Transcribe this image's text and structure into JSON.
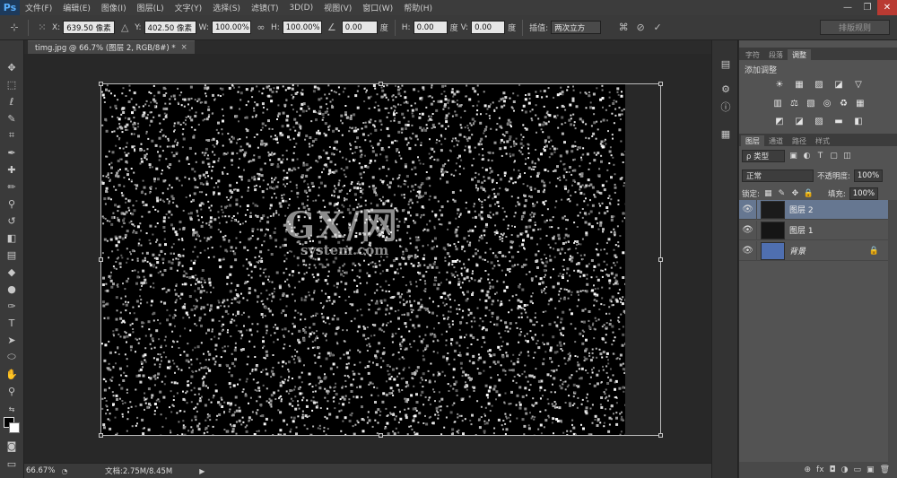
{
  "app": {
    "logo": "Ps"
  },
  "menu": [
    "文件(F)",
    "编辑(E)",
    "图像(I)",
    "图层(L)",
    "文字(Y)",
    "选择(S)",
    "滤镜(T)",
    "3D(D)",
    "视图(V)",
    "窗口(W)",
    "帮助(H)"
  ],
  "window_controls": {
    "minimize": "—",
    "maximize": "❐",
    "close": "✕"
  },
  "options": {
    "x_label": "X:",
    "x_value": "639.50 像素",
    "y_label": "Y:",
    "y_value": "402.50 像素",
    "w_label": "W:",
    "w_value": "100.00%",
    "h_label": "H:",
    "h_value": "100.00%",
    "angle_value": "0.00",
    "angle_unit": "度",
    "hskew_label": "H:",
    "hskew_value": "0.00",
    "hskew_unit": "度",
    "vskew_label": "V:",
    "vskew_value": "0.00",
    "vskew_unit": "度",
    "interp_label": "插值:",
    "interp_value": "两次立方",
    "cancel_icon": "⊘",
    "commit_icon": "✓",
    "workspace": "排版规则"
  },
  "document": {
    "tab_title": "timg.jpg @ 66.7% (图层 2, RGB/8#) *",
    "close": "×"
  },
  "watermark": {
    "big": "GX/网",
    "small": "system.com"
  },
  "status": {
    "zoom": "66.67%",
    "doc_info": "文档:2.75M/8.45M",
    "arrow": "▶"
  },
  "panels": {
    "top_tabs": [
      "字符",
      "段落",
      "调整"
    ],
    "top_active": 2,
    "adj_title": "添加调整",
    "adj_row1": [
      "☀",
      "▦",
      "▨",
      "◪",
      "▽"
    ],
    "adj_row2": [
      "▥",
      "⚖",
      "▧",
      "◎",
      "♻",
      "▦"
    ],
    "adj_row3": [
      "◩",
      "◪",
      "▨",
      "▬",
      "◧"
    ]
  },
  "layers": {
    "tabs": [
      "图层",
      "通道",
      "路径",
      "样式"
    ],
    "active_tab": 0,
    "filter_label": "ρ 类型",
    "blend_mode": "正常",
    "opacity_label": "不透明度:",
    "opacity_value": "100%",
    "lock_label": "锁定:",
    "fill_label": "填充:",
    "fill_value": "100%",
    "items": [
      {
        "name": "图层 2",
        "selected": true,
        "thumb": "#1b1b1b"
      },
      {
        "name": "图层 1",
        "selected": false,
        "thumb": "#151515"
      },
      {
        "name": "背景",
        "selected": false,
        "thumb": "#4f6fb0",
        "italic": true,
        "locked": true
      }
    ],
    "footer": [
      "⊕",
      "fx",
      "◘",
      "◑",
      "▭",
      "▣",
      "🗑"
    ]
  }
}
